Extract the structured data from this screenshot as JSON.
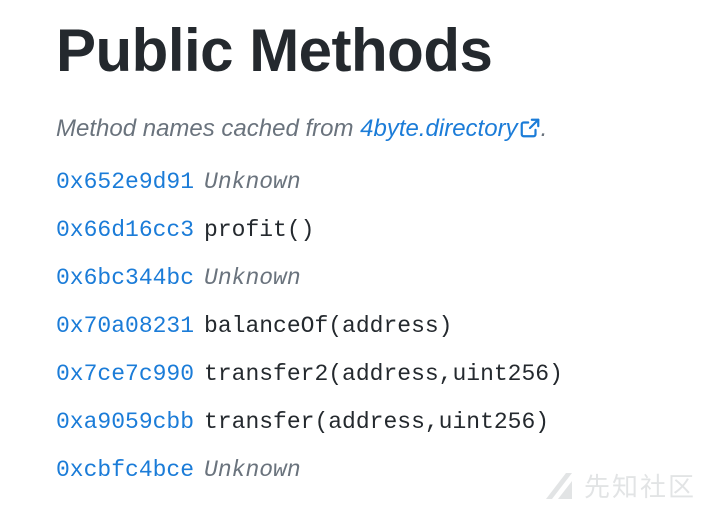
{
  "header": {
    "title": "Public Methods"
  },
  "subtitle": {
    "prefix": "Method names cached from ",
    "link_text": "4byte.directory",
    "suffix": ".",
    "link_icon": "external-link-icon"
  },
  "methods": [
    {
      "selector": "0x652e9d91",
      "signature": "Unknown",
      "known": false
    },
    {
      "selector": "0x66d16cc3",
      "signature": "profit()",
      "known": true
    },
    {
      "selector": "0x6bc344bc",
      "signature": "Unknown",
      "known": false
    },
    {
      "selector": "0x70a08231",
      "signature": "balanceOf(address)",
      "known": true
    },
    {
      "selector": "0x7ce7c990",
      "signature": "transfer2(address,uint256)",
      "known": true
    },
    {
      "selector": "0xa9059cbb",
      "signature": "transfer(address,uint256)",
      "known": true
    },
    {
      "selector": "0xcbfc4bce",
      "signature": "Unknown",
      "known": false
    }
  ],
  "watermark": {
    "text": "先知社区"
  },
  "colors": {
    "link": "#1b7cd8",
    "text": "#24292e",
    "muted": "#6a737d"
  }
}
